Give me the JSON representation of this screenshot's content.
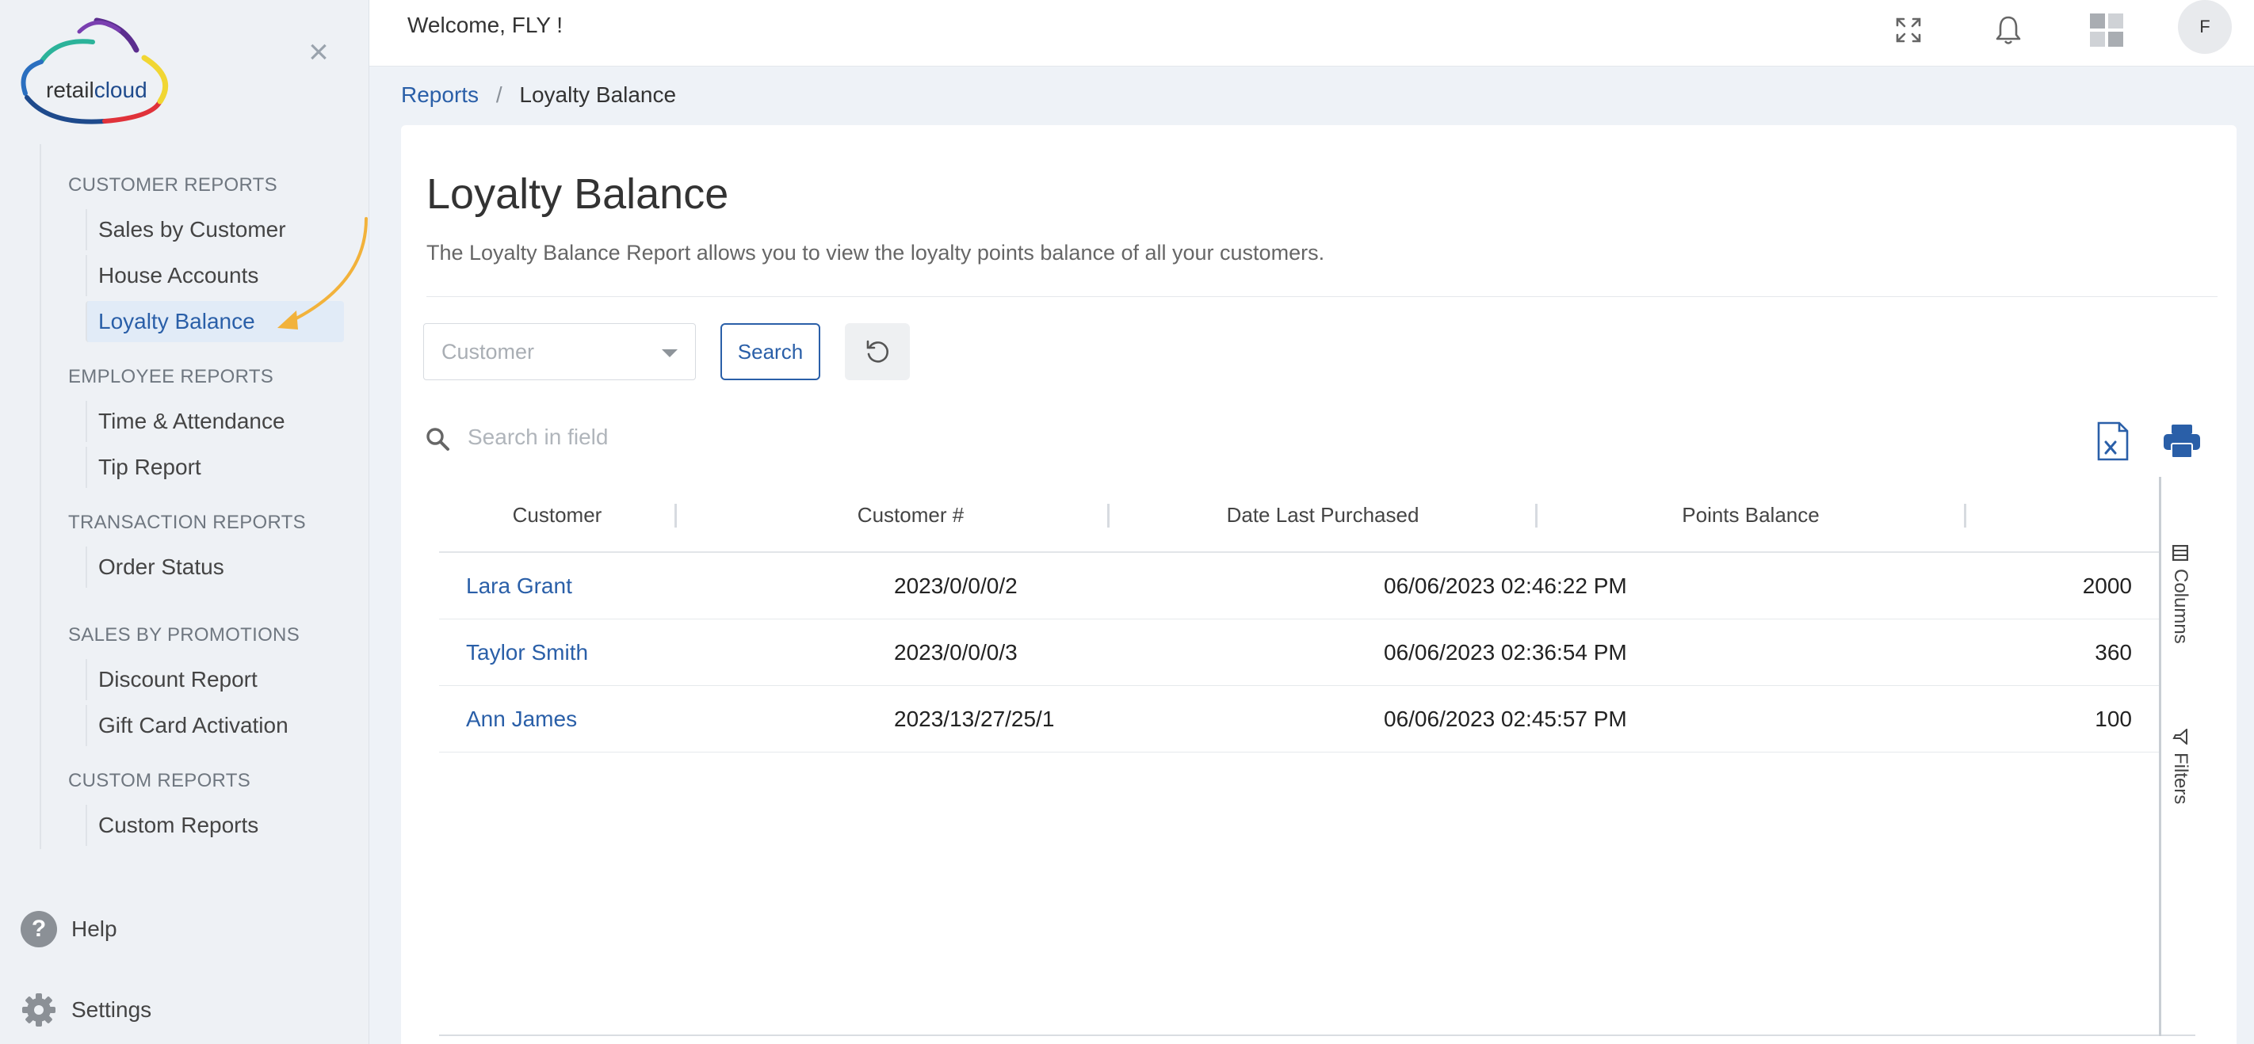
{
  "brand": {
    "logo_part1": "retail",
    "logo_part2": "cloud"
  },
  "sidebar": {
    "sections": [
      {
        "title": "CUSTOMER REPORTS",
        "items": [
          "Sales by Customer",
          "House Accounts",
          "Loyalty Balance"
        ]
      },
      {
        "title": "EMPLOYEE REPORTS",
        "items": [
          "Time & Attendance",
          "Tip Report"
        ]
      },
      {
        "title": "TRANSACTION REPORTS",
        "items": [
          "Order Status"
        ]
      },
      {
        "title": "SALES BY PROMOTIONS",
        "items": [
          "Discount Report",
          "Gift Card Activation"
        ]
      },
      {
        "title": "CUSTOM REPORTS",
        "items": [
          "Custom Reports"
        ]
      }
    ],
    "active_item": "Loyalty Balance",
    "help_label": "Help",
    "help_glyph": "?",
    "settings_label": "Settings"
  },
  "topbar": {
    "welcome": "Welcome, FLY !",
    "avatar_initial": "F"
  },
  "breadcrumb": {
    "parent": "Reports",
    "separator": "/",
    "current": "Loyalty Balance"
  },
  "page": {
    "title": "Loyalty Balance",
    "description": "The Loyalty Balance Report allows you to view the loyalty points balance of all your customers."
  },
  "filters": {
    "customer_placeholder": "Customer",
    "search_label": "Search",
    "field_search_placeholder": "Search in field"
  },
  "table": {
    "columns": [
      "Customer",
      "Customer #",
      "Date Last Purchased",
      "Points Balance"
    ],
    "rows": [
      {
        "customer": "Lara Grant",
        "number": "2023/0/0/0/2",
        "date": "06/06/2023 02:46:22 PM",
        "points": "2000"
      },
      {
        "customer": "Taylor Smith",
        "number": "2023/0/0/0/3",
        "date": "06/06/2023 02:36:54 PM",
        "points": "360"
      },
      {
        "customer": "Ann James",
        "number": "2023/13/27/25/1",
        "date": "06/06/2023 02:45:57 PM",
        "points": "100"
      }
    ],
    "side_tabs": [
      "Columns",
      "Filters"
    ]
  },
  "colors": {
    "accent": "#2a5fa8",
    "annotation_arrow": "#f2b23b"
  }
}
